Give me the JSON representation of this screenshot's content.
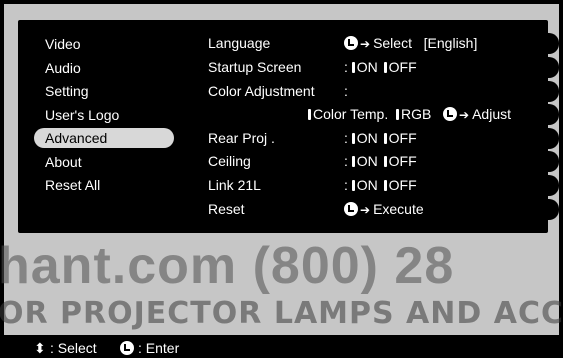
{
  "left_menu": {
    "items": [
      {
        "label": "Video"
      },
      {
        "label": "Audio"
      },
      {
        "label": "Setting"
      },
      {
        "label": "User's Logo"
      },
      {
        "label": "Advanced",
        "active": true
      },
      {
        "label": "About"
      },
      {
        "label": "Reset All"
      }
    ]
  },
  "settings": {
    "language": {
      "label": "Language",
      "action": "Select",
      "current": "[English]"
    },
    "startup": {
      "label": "Startup Screen",
      "sep": ":",
      "on": "ON",
      "off": "OFF"
    },
    "color_adjustment": {
      "label": "Color Adjustment",
      "sep": ":"
    },
    "color_options": {
      "option1": "Color Temp.",
      "option2": "RGB",
      "action": "Adjust"
    },
    "rear_proj": {
      "label": "Rear Proj .",
      "sep": ":",
      "on": "ON",
      "off": "OFF"
    },
    "ceiling": {
      "label": "Ceiling",
      "sep": ":",
      "on": "ON",
      "off": "OFF"
    },
    "link21l": {
      "label": "Link 21L",
      "sep": ":",
      "on": "ON",
      "off": "OFF"
    },
    "reset": {
      "label": "Reset",
      "action": "Execute"
    }
  },
  "watermark": {
    "line1": "hant.com  (800)  28",
    "line2": "OR PROJECTOR LAMPS AND ACCE"
  },
  "footer": {
    "select_label": ": Select",
    "enter_label": ": Enter"
  },
  "colors": {
    "background": "#c6c6c6",
    "menu_bg": "#000000",
    "active_bg": "#d8d8d8"
  }
}
